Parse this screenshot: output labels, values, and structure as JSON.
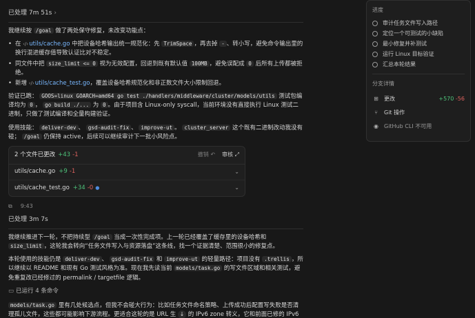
{
  "main": {
    "status1": "已处理 7m 51s",
    "intro": "我继续按 /goal 做了两处保守修复，未改变功能点：",
    "bullets": [
      {
        "a": "在",
        "link": "utils/cache.go",
        "b": "中把设备哈希输出统一规范化：先",
        "code1": "TrimSpace",
        "c": "，再去掉",
        "code2": "-",
        "d": "、转小写，避免命令输出里的换行混进缓存值导致认证比对不稳定。"
      },
      {
        "a": "同文件中把",
        "code1": "size_limit <= 0",
        "b": "视为无效配置，回退到既有默认值",
        "code2": "100MB",
        "c": "，避免误配成",
        "code3": "0",
        "d": "后所有上传都被拒绝。"
      },
      {
        "a": "新增",
        "link": "utils/cache_test.go",
        "b": "，覆盖设备哈希规范化和非正数文件大小限制回退。"
      }
    ],
    "verify": {
      "label": "验证已跑：",
      "code1": "GOOS=linux GOARCH=amd64 go test ./handlers/middleware/cluster/models/utils",
      "a": "测试包编译均为",
      "code2": "0",
      "b": "，",
      "code3": "go build ./...",
      "c": "为",
      "code4": "0",
      "d": "。由于项目含 Linux-only syscall，当前环境没有直接执行 Linux 测试二进制，只做了测试编译和全量构建验证。"
    },
    "skills": {
      "label": "使用技能：",
      "code1": "deliver-dev",
      "a": "、",
      "code2": "gsd-audit-fix",
      "b": "、",
      "code3": "improve-ut",
      "c": "。",
      "code4": "cluster_server",
      "d": "这个既有二进制改动我没有碰；",
      "code5": "/goal",
      "e": "仍保持 active，后续可以继续审计下一批小风险点。"
    },
    "diff": {
      "title": "2 个文件已更改",
      "add": "+43",
      "del": "-1",
      "undo": "撤销",
      "undo_icon": "undo-icon",
      "review": "审核",
      "review_icon": "review-icon",
      "files": [
        {
          "name": "utils/cache.go",
          "add": "+9",
          "del": "-1",
          "dot": ""
        },
        {
          "name": "utils/cache_test.go",
          "add": "+34",
          "del": "-0",
          "dot": "●"
        }
      ]
    },
    "actions": {
      "copy_icon": "copy-icon",
      "time": "9:43"
    },
    "status2": "已处理 3m 7s",
    "p2": {
      "a": "我继续推进下一轮，不把持续型",
      "code1": "/goal",
      "b": "当成一次性完成项。上一轮已经覆盖了缓存里的设备哈希和",
      "code2": "size_limit",
      "c": "，这轮我会转向“任务文件写入与资源落盘”这条线，找一个证据清楚、范围很小的修复点。"
    },
    "p3": {
      "a": "本轮使用的技能仍是",
      "code1": "deliver-dev",
      "b": "、",
      "code2": "gsd-audit-fix",
      "c": "和",
      "code3": "improve-ut",
      "d": "的轻量路径：项目没有",
      "code4": ".trellis",
      "e": "，所以继续以 README 和现有 Go 测试风格为准。现在我先读当前",
      "code5": "models/task.go",
      "f": "的写文件区域和相关测试，避免重复改已经修过的 permalink / targetfile 逻辑。"
    },
    "ran": "已运行 4 条命令",
    "p4": {
      "code1": "models/task.go",
      "a": "里有几处候选点，但我不会碰大行为：比如任务文件命名策略、上传成功后配置写失败是否清理孤儿文件，这些都可能影响下游流程。更适合这轮的是 URL 生",
      "b": "的 IPv6 zone 转义，它和前面已修的 IPv6 URL 问题同类，范围小、可测试。"
    }
  },
  "side": {
    "progress_title": "进度",
    "progress": [
      "审计任务文件写入路径",
      "定位一个可测试的小缺陷",
      "最小修复并补测试",
      "运行 Linux 目标验证",
      "汇总本轮结果"
    ],
    "details_title": "分支详情",
    "details": [
      {
        "label": "更改",
        "icon": "changes-icon",
        "add": "+570",
        "del": "-56"
      },
      {
        "label": "Git 操作",
        "icon": "git-icon"
      },
      {
        "label": "GitHub CLI 不可用",
        "icon": "github-icon"
      }
    ]
  }
}
